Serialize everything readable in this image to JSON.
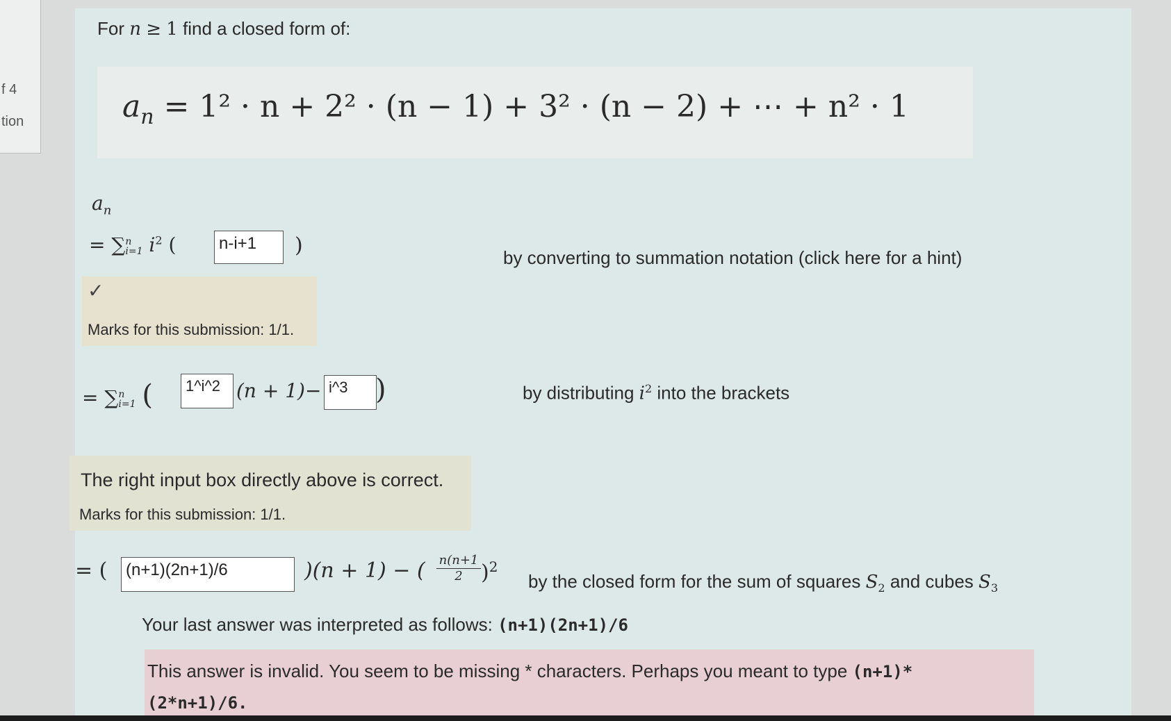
{
  "sidebar": {
    "line1": "f 4",
    "line2": "tion"
  },
  "intro": {
    "prefix": "For",
    "var": "n",
    "relation": "≥",
    "number": "1",
    "suffix": "find a closed form of:"
  },
  "main_formula": "= 1² · n + 2² · (n − 1) + 3² · (n − 2) + ⋯ + n² · 1",
  "step1": {
    "lhs": "a",
    "lhs_sub": "n",
    "sum_prefix": "= ∑",
    "sum_lower": "i=1",
    "sum_upper": "n",
    "term": "i",
    "term_exp": "2",
    "open_paren": "(",
    "close_paren": ")",
    "input_value": "n-i+1",
    "explanation": "by converting to summation notation (click here for a hint)",
    "check_mark": "✓",
    "marks": "Marks for this submission: 1/1."
  },
  "step2": {
    "sum_prefix": "= ∑",
    "sum_lower": "i=1",
    "sum_upper": "n",
    "open_paren": "(",
    "close_paren": ")",
    "input1_value": "1^i^2",
    "middle": "(n + 1)−",
    "input2_value": "i^3",
    "explanation_prefix": "by distributing",
    "explanation_var": "i",
    "explanation_exp": "2",
    "explanation_suffix": "into the brackets",
    "correct_msg": "The right input box directly above is correct.",
    "marks": "Marks for this submission: 1/1."
  },
  "step3": {
    "prefix": "= (",
    "input_value": "(n+1)(2n+1)/6",
    "middle": ")(n + 1) − (",
    "frac_num": "n(n+1",
    "frac_den": "2",
    "close": ")",
    "power": "2",
    "explanation_prefix": "by the closed form for the sum of squares",
    "s2": "S",
    "s2_sub": "2",
    "and_text": "and cubes",
    "s3": "S",
    "s3_sub": "3",
    "interpreted_label": "Your last answer was interpreted as follows:",
    "interpreted_value": "(n+1)(2n+1)/6",
    "invalid_text": "This answer is invalid. You seem to be missing * characters. Perhaps you meant to type",
    "suggest_line1": "(n+1)*",
    "suggest_line2": "(2*n+1)/6."
  },
  "colors": {
    "panel": "#dde8e8",
    "formula_box": "#e9edeb",
    "ok_feedback": "#e7e2cf",
    "invalid_feedback": "#e8cfd4"
  }
}
